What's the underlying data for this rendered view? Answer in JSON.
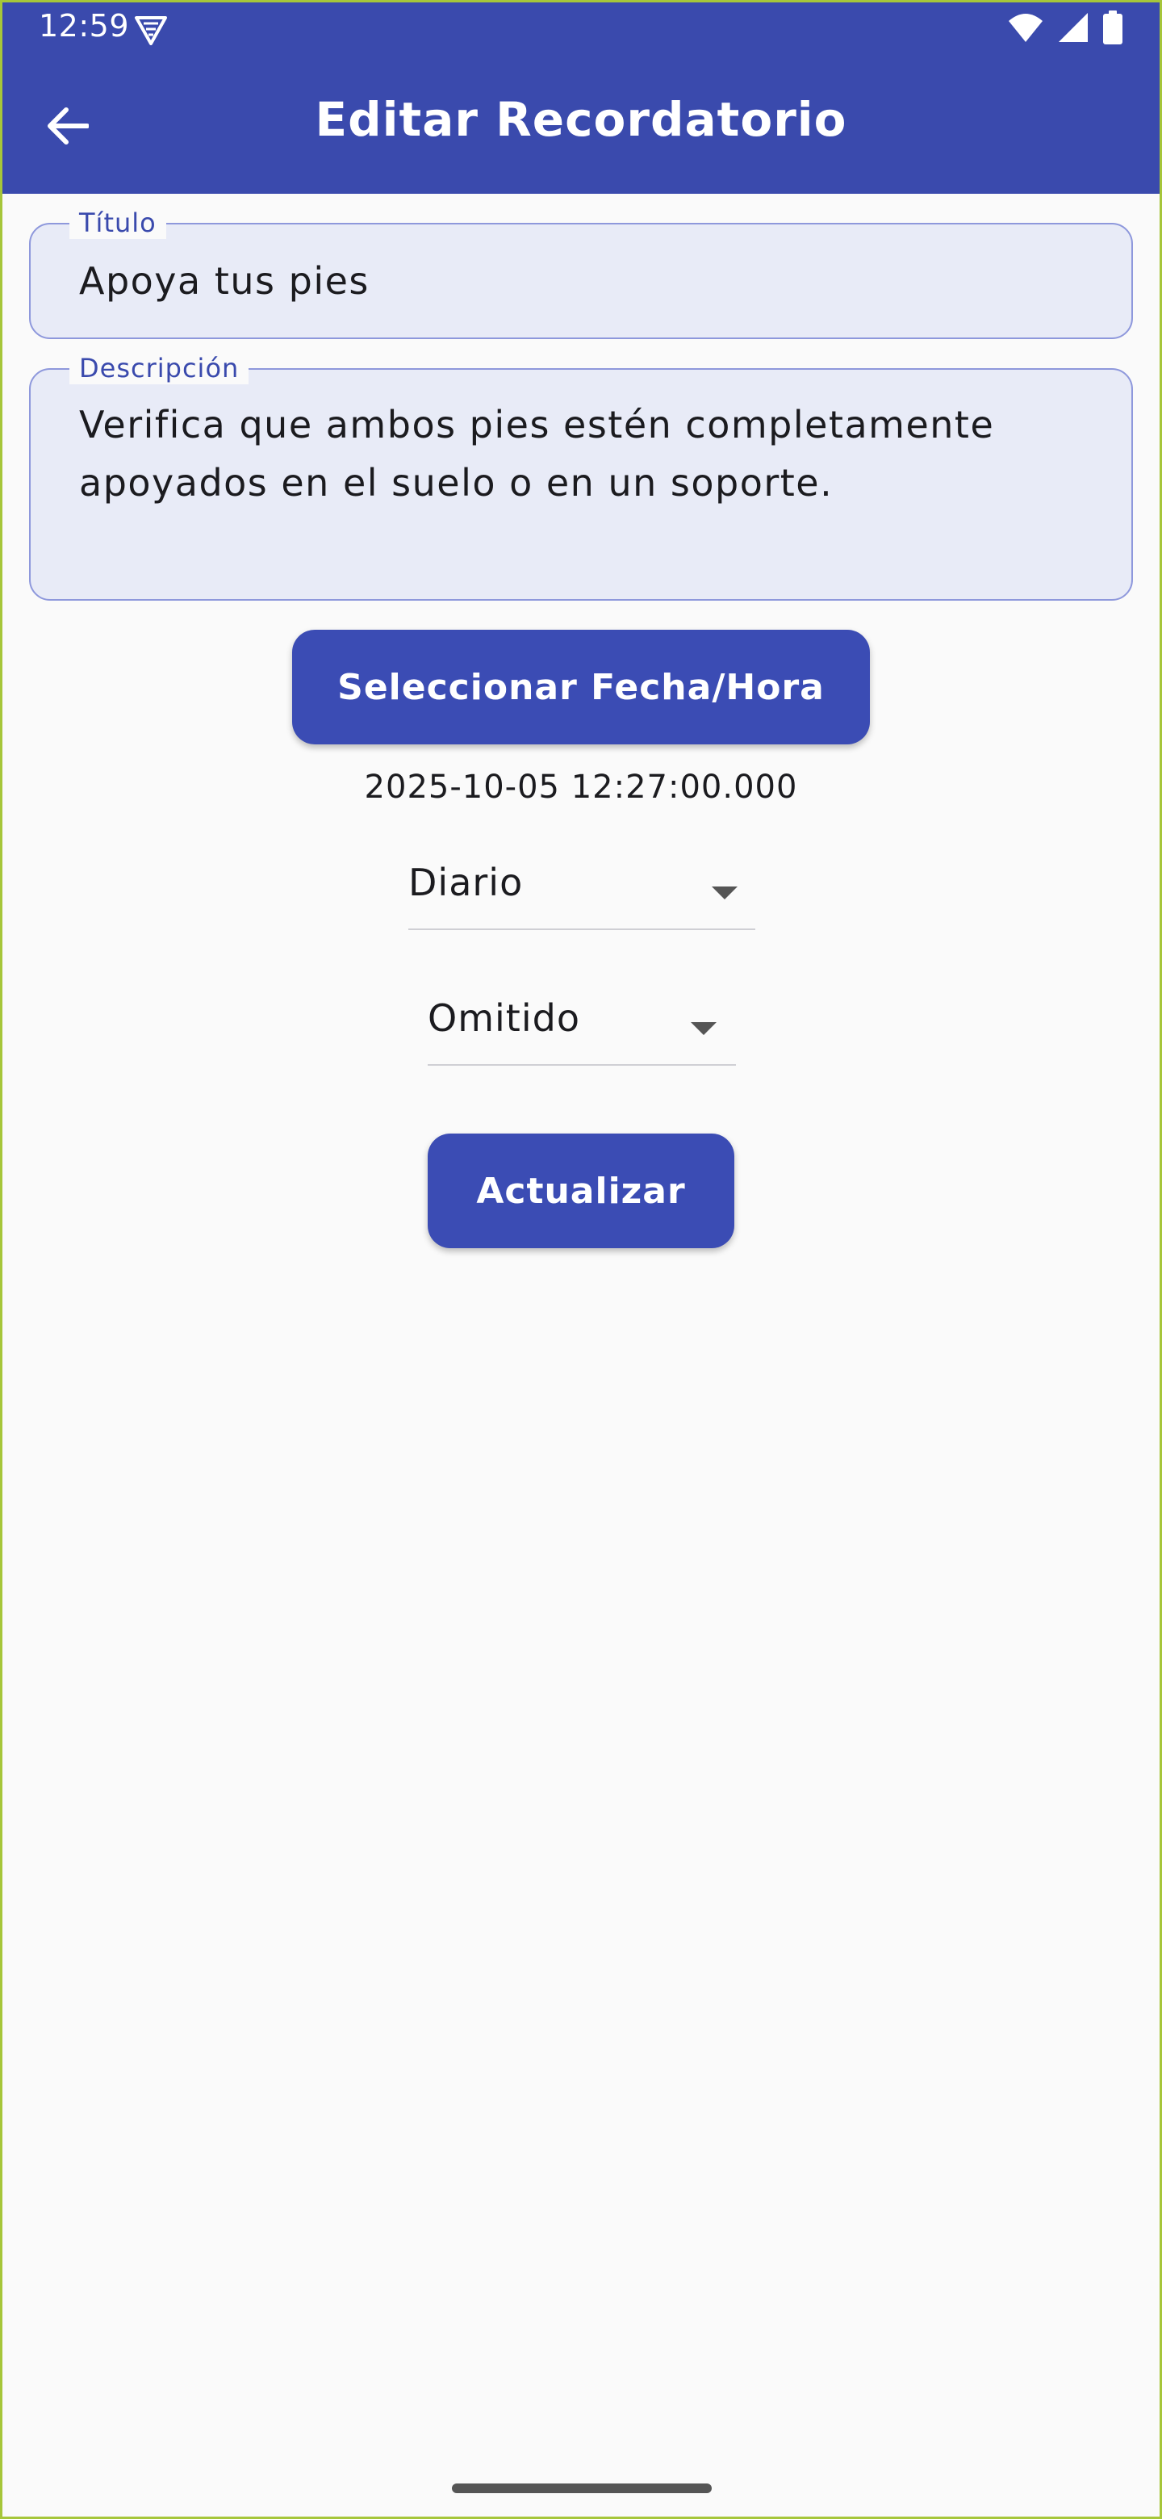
{
  "status_bar": {
    "time": "12:59"
  },
  "app_bar": {
    "title": "Editar Recordatorio",
    "back_icon": "arrow-left-icon",
    "color": "#3a4aad"
  },
  "form": {
    "title_field": {
      "label": "Título",
      "value": "Apoya tus pies"
    },
    "description_field": {
      "label": "Descripción",
      "value": "Verifica que ambos pies estén completamente apoyados en el suelo o en un soporte."
    },
    "select_datetime_button": "Seleccionar Fecha/Hora",
    "selected_datetime": "2025-10-05 12:27:00.000",
    "frequency_dropdown": {
      "value": "Diario"
    },
    "status_dropdown": {
      "value": "Omitido"
    },
    "update_button": "Actualizar"
  }
}
